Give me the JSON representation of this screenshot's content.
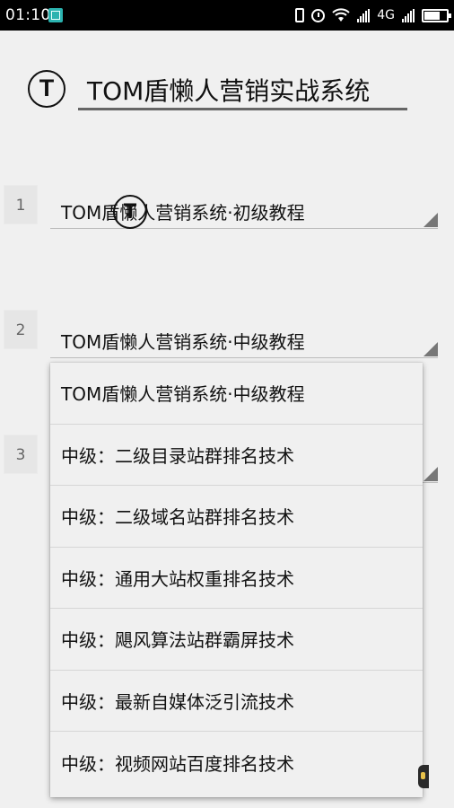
{
  "status_bar": {
    "time": "01:10",
    "network": "4G"
  },
  "header": {
    "logo_letter": "T",
    "title": "TOM盾懒人营销实战系统"
  },
  "rows": [
    {
      "number": "1",
      "selected": "TOM盾懒人营销系统·初级教程"
    },
    {
      "number": "2",
      "selected": "TOM盾懒人营销系统·中级教程"
    },
    {
      "number": "3",
      "selected": ""
    }
  ],
  "floating_logo": "T",
  "dropdown": {
    "items": [
      "TOM盾懒人营销系统·中级教程",
      "中级：二级目录站群排名技术",
      "中级：二级域名站群排名技术",
      "中级：通用大站权重排名技术",
      "中级：飓风算法站群霸屏技术",
      "中级：最新自媒体泛引流技术",
      "中级：视频网站百度排名技术"
    ]
  },
  "icons": [
    "vibrate-icon",
    "alarm-icon",
    "wifi-icon",
    "signal-icon",
    "battery-icon",
    "screenshot-app-icon",
    "dropdown-arrow-icon"
  ]
}
